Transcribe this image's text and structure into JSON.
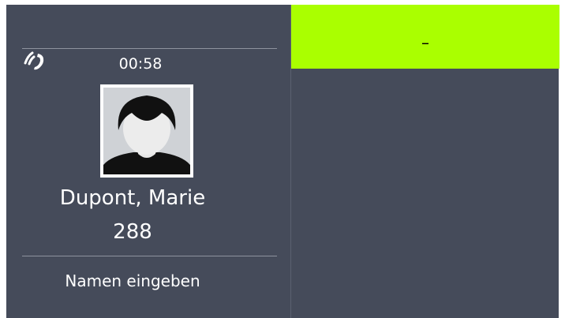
{
  "call": {
    "timer": "00:58",
    "status_icon": "ringing-phone-icon"
  },
  "contact": {
    "name": "Dupont, Marie",
    "number": "288",
    "avatar_icon": "person-silhouette-icon"
  },
  "actions": {
    "enter_name_label": "Namen eingeben"
  },
  "input": {
    "value": "–"
  },
  "colors": {
    "background": "#454b5a",
    "accent": "#aaff00",
    "text": "#ffffff",
    "divider": "#8e939e"
  }
}
